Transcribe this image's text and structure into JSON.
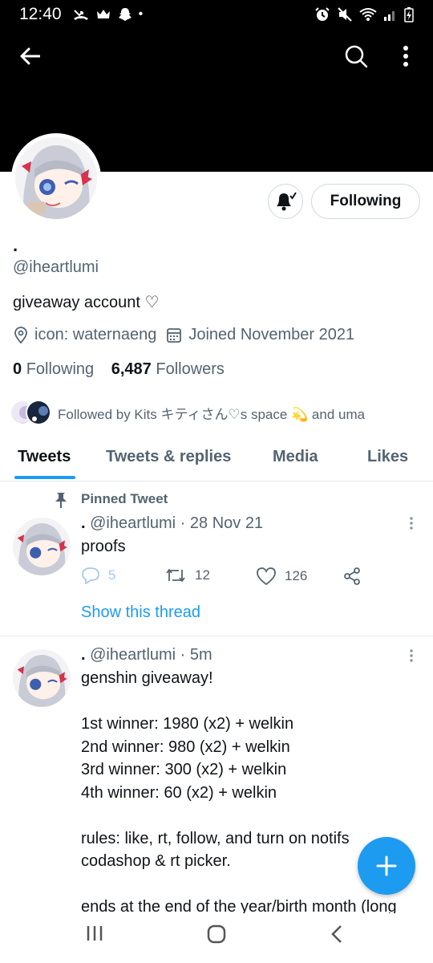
{
  "status_bar": {
    "time": "12:40",
    "dot": "•"
  },
  "profile": {
    "name": ".",
    "handle": "@iheartlumi",
    "bio": "giveaway account ♡",
    "location": "icon: waternaeng",
    "joined": "Joined November 2021",
    "following_count": "0",
    "following_label": "Following",
    "followers_count": "6,487",
    "followers_label": "Followers",
    "followed_by": "Followed by Kits キティさん♡s space 💫 and uma",
    "follow_button": "Following"
  },
  "tabs": [
    {
      "label": "Tweets"
    },
    {
      "label": "Tweets & replies"
    },
    {
      "label": "Media"
    },
    {
      "label": "Likes"
    }
  ],
  "pinned": {
    "label": "Pinned Tweet",
    "name": ".",
    "meta": "@iheartlumi · 28 Nov 21",
    "text": "proofs",
    "replies": "5",
    "retweets": "12",
    "likes": "126",
    "show_thread": "Show this thread"
  },
  "tweet2": {
    "name": ".",
    "meta": "@iheartlumi · 5m",
    "text": "genshin giveaway!\n\n1st winner: 1980 (x2) + welkin\n2nd winner: 980 (x2) + welkin\n3rd winner: 300 (x2) + welkin\n4th winner: 60 (x2) + welkin\n\nrules: like, rt, follow, and turn on notifs\ncodashop & rt picker.\n\nends at the end of the year/birth month (long"
  },
  "colors": {
    "accent": "#1d9bf0",
    "muted": "#536471",
    "text": "#0f1419",
    "border": "#cfd9de"
  }
}
